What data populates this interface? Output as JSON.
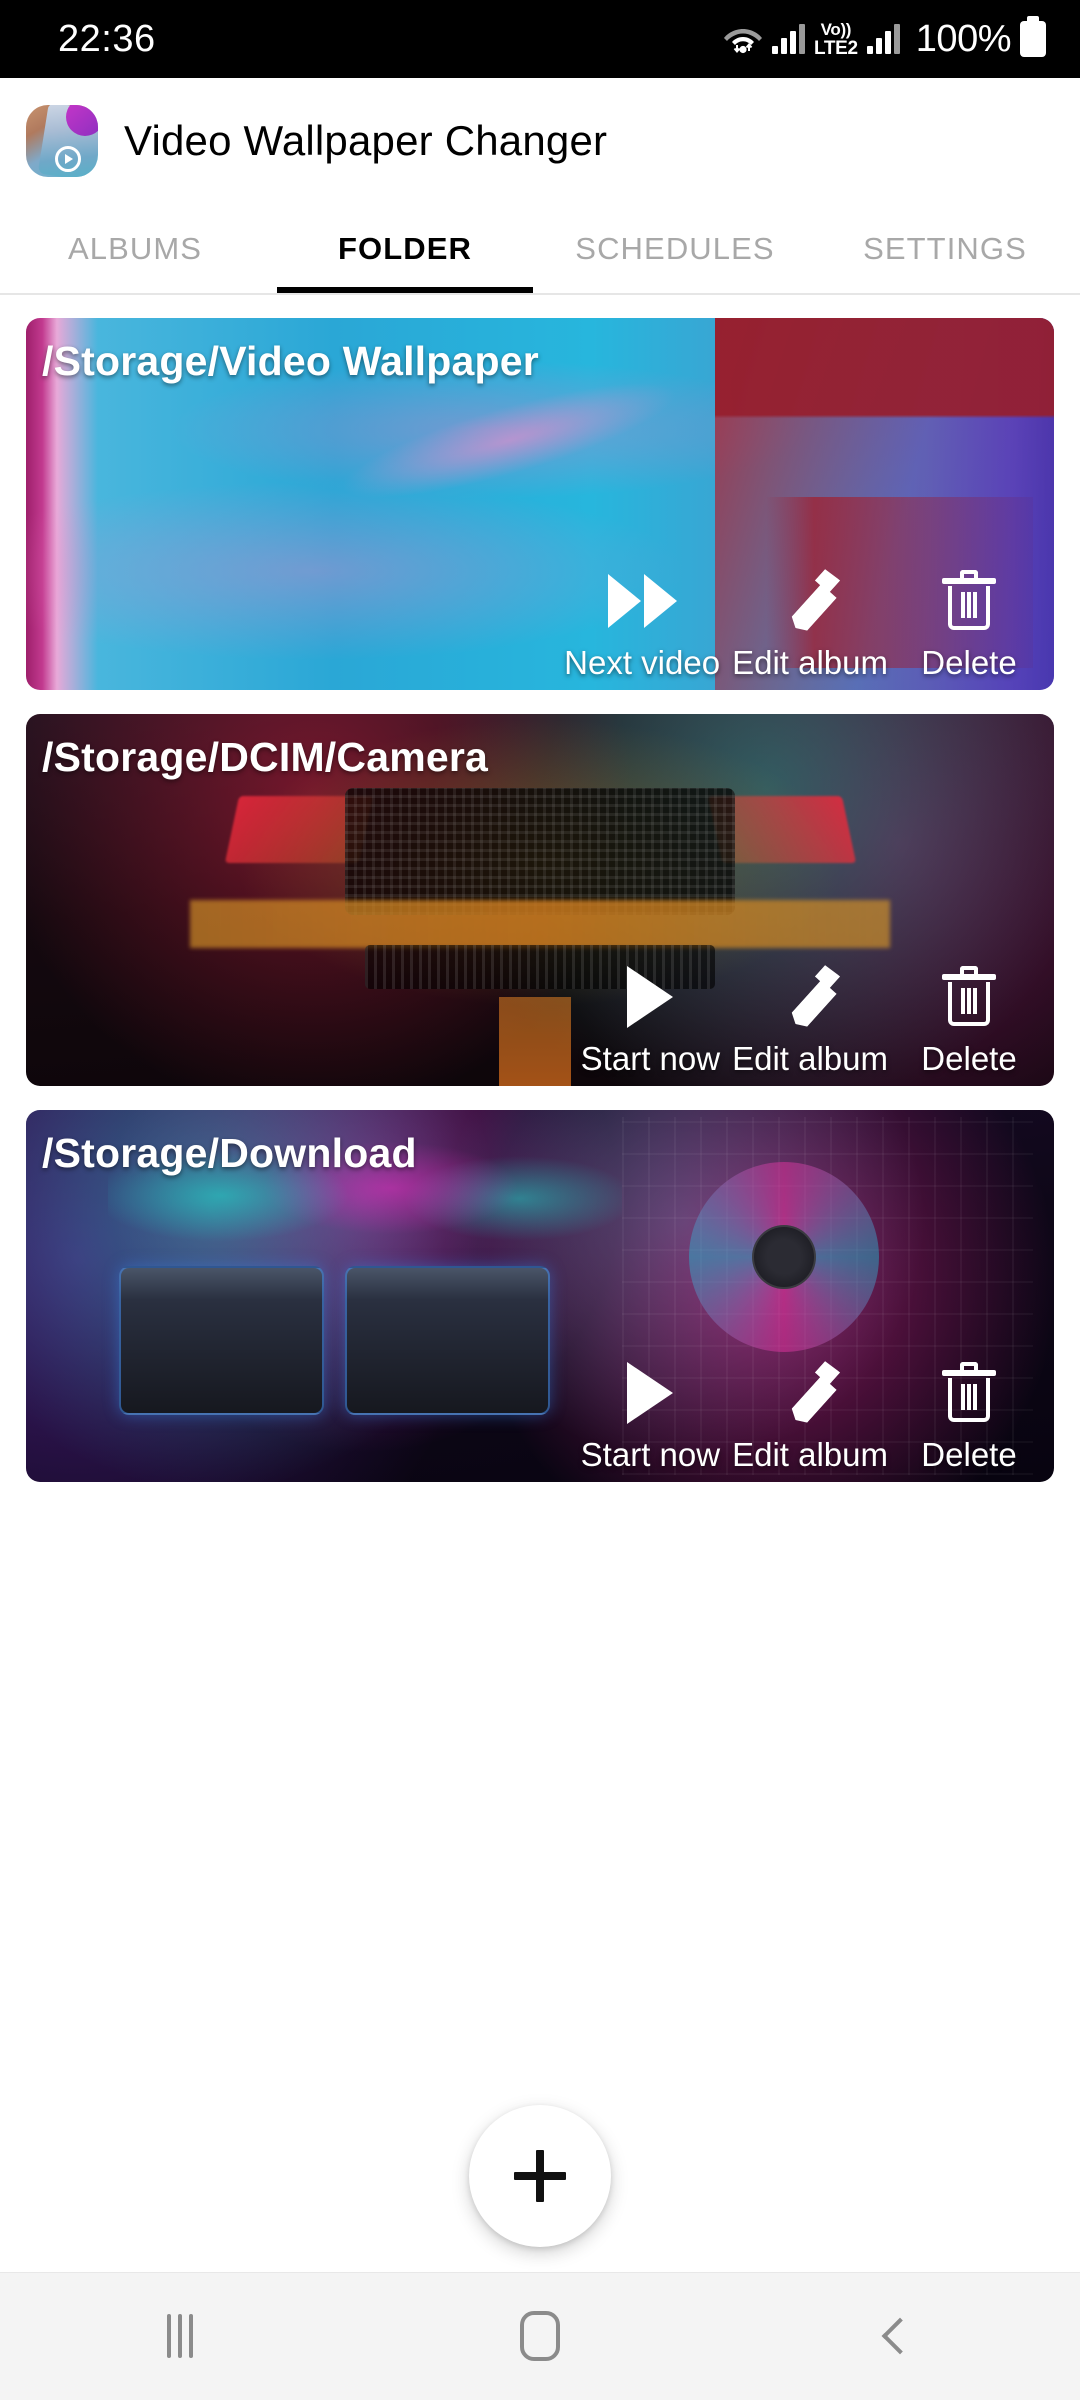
{
  "status_bar": {
    "time": "22:36",
    "battery_percent": "100%",
    "icons": [
      "wifi-icon",
      "signal-bars-icon",
      "volte-icon",
      "signal-bars-icon",
      "battery-icon"
    ],
    "volte_top": "Vo))",
    "volte_bottom": "LTE2"
  },
  "app_bar": {
    "title": "Video Wallpaper Changer",
    "logo": "app-logo-icon"
  },
  "tabs": [
    {
      "label": "ALBUMS",
      "active": false
    },
    {
      "label": "FOLDER",
      "active": true
    },
    {
      "label": "SCHEDULES",
      "active": false
    },
    {
      "label": "SETTINGS",
      "active": false
    }
  ],
  "folders": [
    {
      "path": "/Storage/Video Wallpaper",
      "actions": [
        {
          "label": "Next video",
          "icon": "fast-forward-icon"
        },
        {
          "label": "Edit album",
          "icon": "pencil-icon"
        },
        {
          "label": "Delete",
          "icon": "trash-icon"
        }
      ]
    },
    {
      "path": "/Storage/DCIM/Camera",
      "actions": [
        {
          "label": "Start now",
          "icon": "play-icon"
        },
        {
          "label": "Edit album",
          "icon": "pencil-icon"
        },
        {
          "label": "Delete",
          "icon": "trash-icon"
        }
      ]
    },
    {
      "path": "/Storage/Download",
      "actions": [
        {
          "label": "Start now",
          "icon": "play-icon"
        },
        {
          "label": "Edit album",
          "icon": "pencil-icon"
        },
        {
          "label": "Delete",
          "icon": "trash-icon"
        }
      ]
    }
  ],
  "fab": {
    "icon": "plus-icon",
    "label": "+"
  },
  "nav_bar": {
    "recents": "recents-icon",
    "home": "home-icon",
    "back": "back-icon"
  },
  "colors": {
    "status_bar_bg": "#000000",
    "app_bg": "#ffffff",
    "tab_active": "#000000",
    "tab_inactive": "#a8a8a8",
    "nav_bar_bg": "#f4f4f4",
    "nav_icon": "#8b8b8b"
  }
}
